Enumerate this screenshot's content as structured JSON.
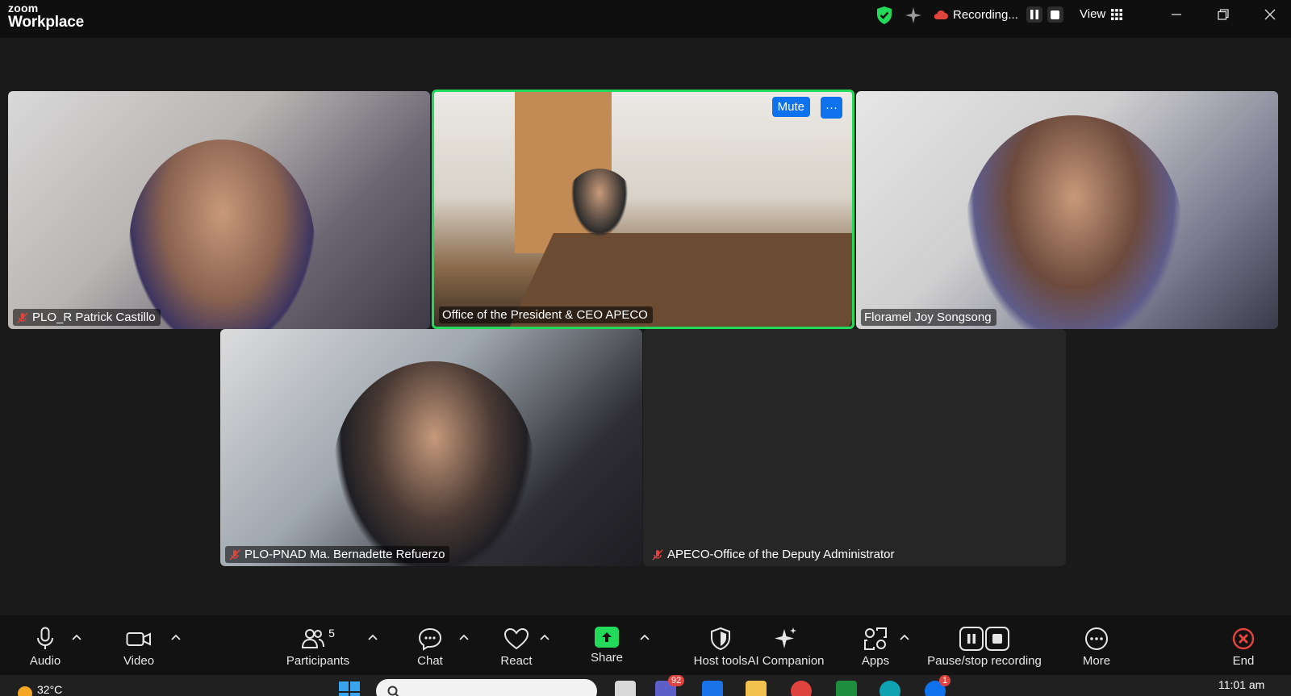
{
  "app": {
    "brand_top": "zoom",
    "brand_bottom": "Workplace"
  },
  "titlebar": {
    "recording_label": "Recording...",
    "view_label": "View"
  },
  "participants": [
    {
      "name": "PLO_R Patrick Castillo",
      "muted": true
    },
    {
      "name": "Office of the President & CEO APECO",
      "muted": false,
      "active_speaker": true
    },
    {
      "name": "Floramel Joy Songsong",
      "muted": false
    },
    {
      "name": "PLO-PNAD Ma. Bernadette Refuerzo",
      "muted": true
    },
    {
      "name": "APECO-Office of the Deputy Administrator",
      "muted": true
    }
  ],
  "tile_controls": {
    "mute_label": "Mute",
    "more_label": "···"
  },
  "toolbar": {
    "audio": "Audio",
    "video": "Video",
    "participants": "Participants",
    "participants_count": "5",
    "chat": "Chat",
    "react": "React",
    "share": "Share",
    "host_tools": "Host tools",
    "ai_companion": "AI Companion",
    "apps": "Apps",
    "pause_stop": "Pause/stop recording",
    "more": "More",
    "end": "End"
  },
  "taskbar": {
    "temperature": "32°C",
    "teams_badge": "92",
    "zoom_badge": "1",
    "time": "11:01 am"
  },
  "colors": {
    "active_border": "#23d959",
    "accent_blue": "#0e72ed",
    "end_red": "#e0443e",
    "share_green": "#23d959"
  }
}
